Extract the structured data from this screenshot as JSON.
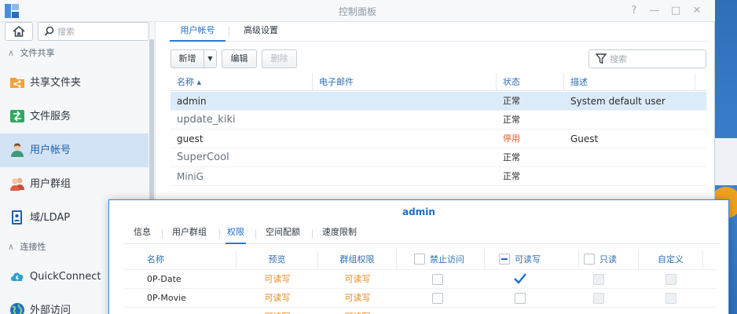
{
  "window": {
    "title": "控制面板",
    "controls": [
      "?",
      "—",
      "□",
      "✕"
    ]
  },
  "sidebar": {
    "search_placeholder": "搜索",
    "sections": [
      {
        "label": "文件共享"
      },
      {
        "label": "连接性"
      }
    ],
    "items": [
      {
        "label": "共享文件夹",
        "icon": "shared-folder-icon"
      },
      {
        "label": "文件服务",
        "icon": "file-services-icon"
      },
      {
        "label": "用户帐号",
        "icon": "user-icon",
        "selected": true
      },
      {
        "label": "用户群组",
        "icon": "group-icon"
      },
      {
        "label": "域/LDAP",
        "icon": "domain-ldap-icon"
      },
      {
        "label": "QuickConnect",
        "icon": "quickconnect-icon"
      },
      {
        "label": "外部访问",
        "icon": "globe-icon"
      }
    ]
  },
  "main": {
    "tabs": [
      {
        "label": "用户帐号",
        "active": true
      },
      {
        "label": "高级设置",
        "active": false
      }
    ],
    "toolbar": {
      "add_label": "新增",
      "edit_label": "编辑",
      "delete_label": "删除",
      "filter_placeholder": "搜索"
    },
    "grid": {
      "columns": [
        "名称 ▴",
        "电子邮件",
        "状态",
        "描述"
      ],
      "rows": [
        {
          "name": "admin",
          "email": "",
          "status": "正常",
          "desc": "System default user",
          "selected": true
        },
        {
          "name": "update_kiki",
          "email": "",
          "status": "正常",
          "desc": ""
        },
        {
          "name": "guest",
          "email": "",
          "status": "停用",
          "desc": "Guest",
          "disabled": true
        },
        {
          "name": "SuperCool",
          "email": "",
          "status": "正常",
          "desc": ""
        },
        {
          "name": "MiniG",
          "email": "",
          "status": "正常",
          "desc": ""
        }
      ]
    }
  },
  "dialog": {
    "title": "admin",
    "tabs": [
      {
        "label": "信息"
      },
      {
        "label": "用户群组"
      },
      {
        "label": "权限",
        "active": true
      },
      {
        "label": "空间配额"
      },
      {
        "label": "速度限制"
      }
    ],
    "columns": {
      "name": "名称",
      "preview": "预览",
      "group_perm": "群组权限",
      "deny": "禁止访问",
      "rw": "可读写",
      "ro": "只读",
      "custom": "自定义"
    },
    "rows": [
      {
        "name": "0P-Date",
        "preview": "可读写",
        "group_perm": "可读写",
        "deny": false,
        "rw": true,
        "ro": false,
        "custom": false
      },
      {
        "name": "0P-Movie",
        "preview": "可读写",
        "group_perm": "可读写",
        "deny": false,
        "rw": false,
        "ro": false,
        "custom": false
      },
      {
        "name": "",
        "preview": "可读写",
        "group_perm": "可读写",
        "deny": false,
        "rw": false,
        "ro": false,
        "custom": false
      }
    ]
  },
  "colors": {
    "accent": "#1f6fc5",
    "selected_row": "#dcebfa",
    "status_disabled": "#e85b2a",
    "permission_orange": "#e8891e",
    "desktop_blue": "#3b79c3"
  }
}
